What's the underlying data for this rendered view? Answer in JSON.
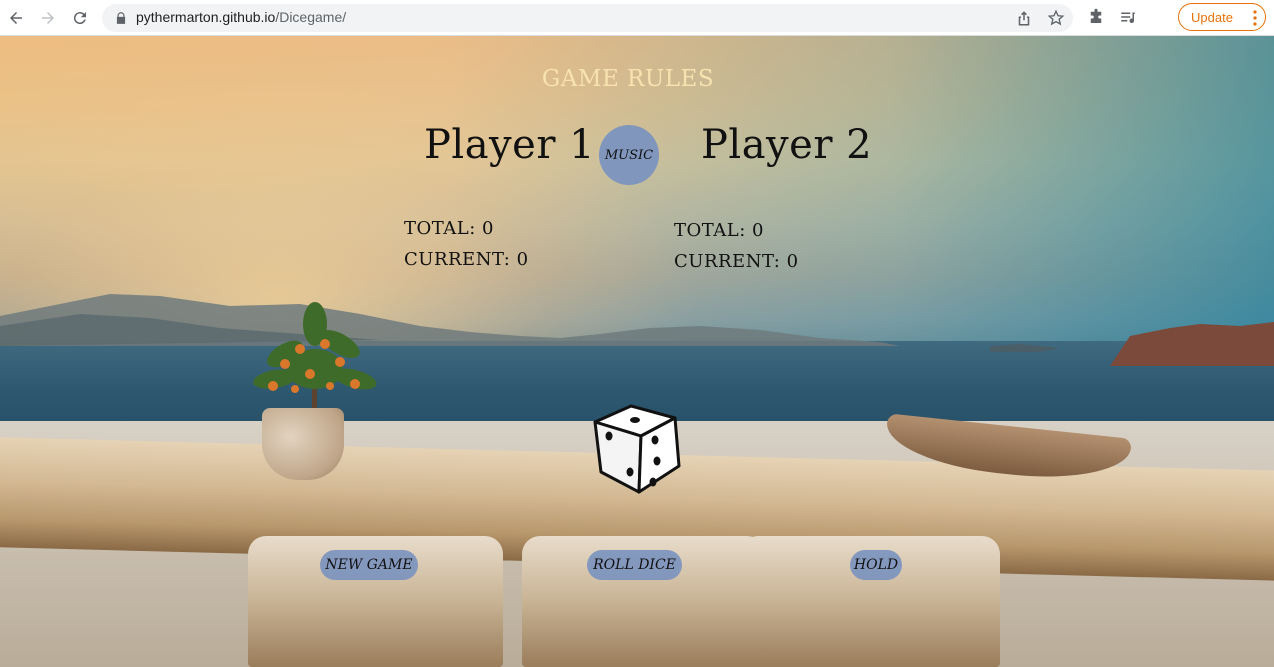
{
  "browser": {
    "url_host": "pythermarton.github.io",
    "url_path": "/Dicegame/",
    "update_label": "Update"
  },
  "game": {
    "rules_label": "GAME RULES",
    "music_label": "MUSIC",
    "players": [
      {
        "name": "Player 1",
        "total_label": "TOTAL: 0",
        "current_label": "CURRENT: 0"
      },
      {
        "name": "Player 2",
        "total_label": "TOTAL: 0",
        "current_label": "CURRENT: 0"
      }
    ],
    "dice_face": 3,
    "buttons": {
      "new_game": "NEW GAME",
      "roll_dice": "ROLL DICE",
      "hold": "HOLD"
    },
    "button_color": "#7a92bf",
    "rules_color": "#f8e3b0"
  }
}
